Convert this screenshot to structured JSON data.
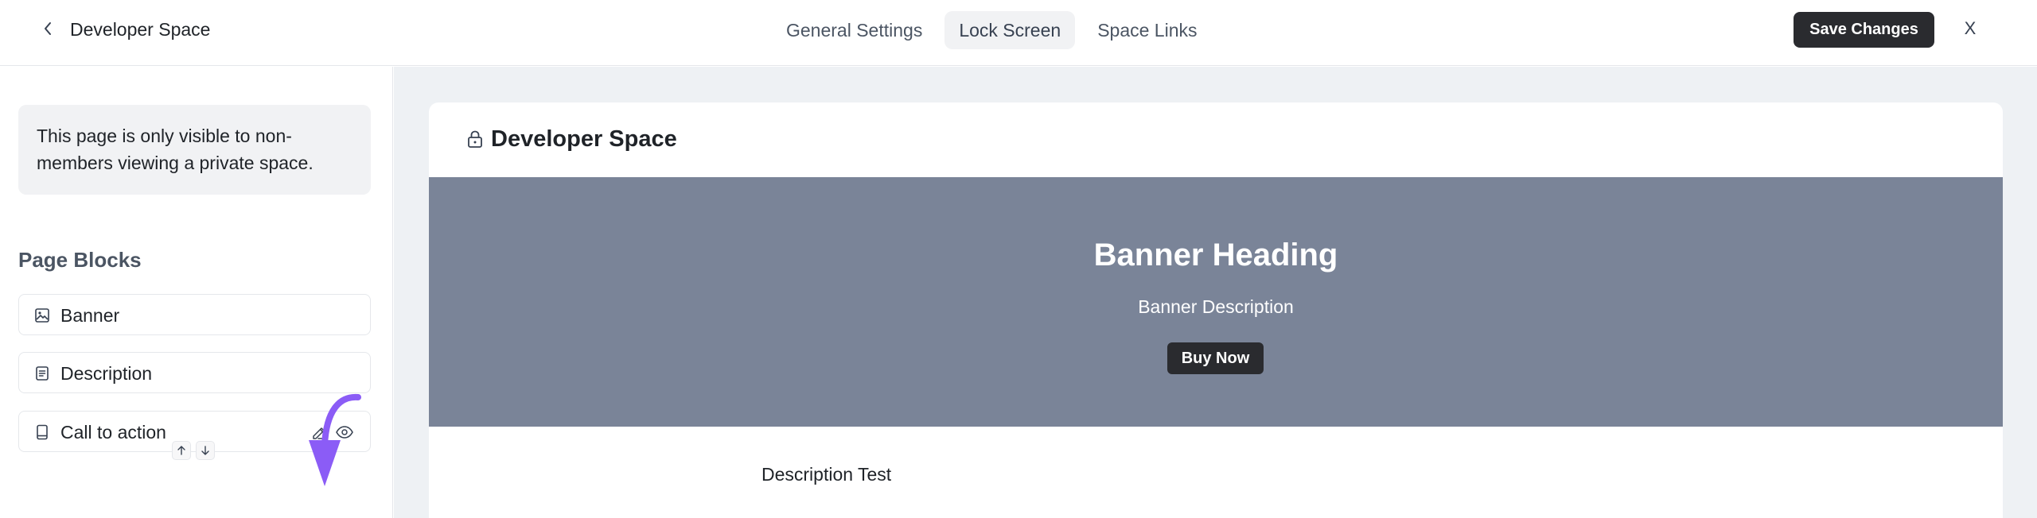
{
  "header": {
    "space_title": "Developer Space",
    "tabs": [
      {
        "label": "General Settings",
        "active": false
      },
      {
        "label": "Lock Screen",
        "active": true
      },
      {
        "label": "Space Links",
        "active": false
      }
    ],
    "save_label": "Save Changes",
    "close_label": "X"
  },
  "sidebar": {
    "info_text": "This page is only visible to non-members viewing a private space.",
    "blocks_title": "Page Blocks",
    "blocks": [
      {
        "label": "Banner",
        "icon": "image-icon"
      },
      {
        "label": "Description",
        "icon": "document-icon"
      },
      {
        "label": "Call to action",
        "icon": "tablet-icon"
      }
    ]
  },
  "preview": {
    "title": "Developer Space",
    "banner_heading": "Banner Heading",
    "banner_description": "Banner Description",
    "button_label": "Buy Now",
    "description_text": "Description Test"
  },
  "colors": {
    "banner": "#7a8498",
    "primary_button": "#2a2b2f",
    "annotation_arrow": "#8b5cf6",
    "preview_background": "#eef1f4"
  }
}
